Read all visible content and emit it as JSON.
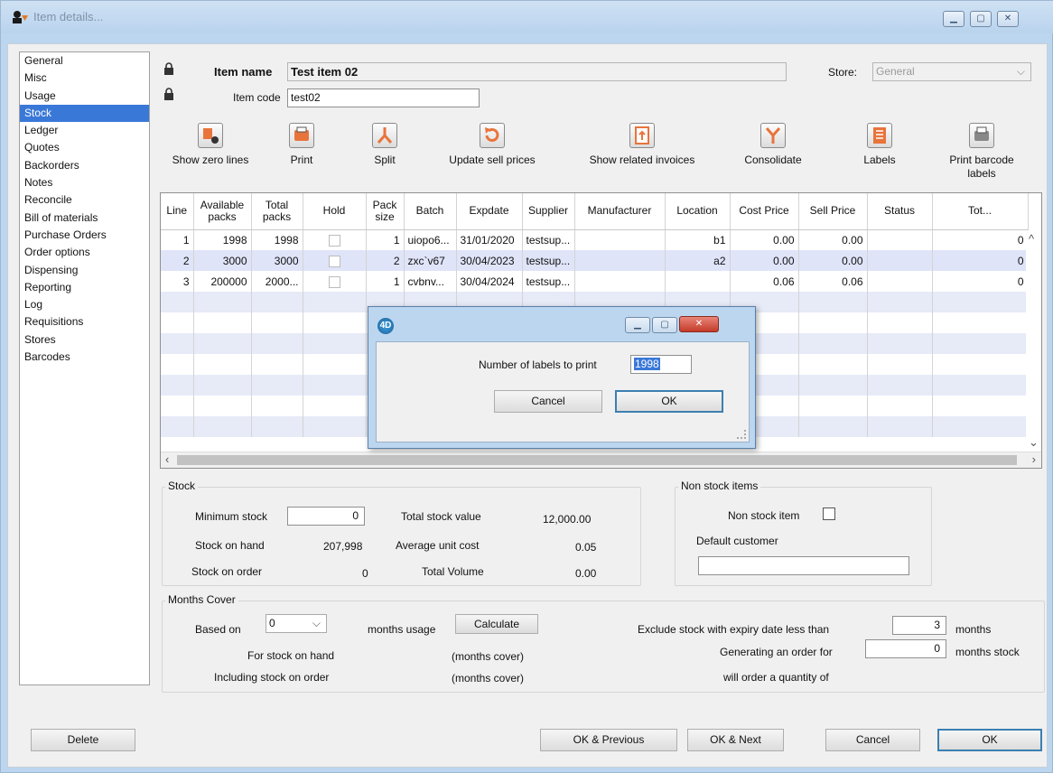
{
  "window": {
    "title": "Item details..."
  },
  "nav": {
    "items": [
      "General",
      "Misc",
      "Usage",
      "Stock",
      "Ledger",
      "Quotes",
      "Backorders",
      "Notes",
      "Reconcile",
      "Bill of materials",
      "Purchase Orders",
      "Order options",
      "Dispensing",
      "Reporting",
      "Log",
      "Requisitions",
      "Stores",
      "Barcodes"
    ],
    "selected": "Stock"
  },
  "header": {
    "item_name_label": "Item name",
    "item_name_value": "Test item 02",
    "item_code_label": "Item code",
    "item_code_value": "test02",
    "store_label": "Store:",
    "store_value": "General"
  },
  "toolbar": {
    "show_zero_lines": "Show zero lines",
    "print": "Print",
    "split": "Split",
    "update_sell_prices": "Update sell prices",
    "show_related_invoices": "Show related invoices",
    "consolidate": "Consolidate",
    "labels": "Labels",
    "print_barcode_labels": "Print barcode labels"
  },
  "table": {
    "columns": [
      "Line",
      "Available packs",
      "Total packs",
      "Hold",
      "Pack size",
      "Batch",
      "Expdate",
      "Supplier",
      "Manufacturer",
      "Location",
      "Cost Price",
      "Sell Price",
      "Status",
      "Tot..."
    ],
    "rows": [
      {
        "line": "1",
        "available": "1998",
        "total": "1998",
        "pack": "1",
        "batch": "uiopo6...",
        "expdate": "31/01/2020",
        "supplier": "testsup...",
        "manufacturer": "",
        "location": "b1",
        "cost": "0.00",
        "sell": "0.00",
        "status": "",
        "tot": "0"
      },
      {
        "line": "2",
        "available": "3000",
        "total": "3000",
        "pack": "2",
        "batch": "zxc`v67",
        "expdate": "30/04/2023",
        "supplier": "testsup...",
        "manufacturer": "",
        "location": "a2",
        "cost": "0.00",
        "sell": "0.00",
        "status": "",
        "tot": "0"
      },
      {
        "line": "3",
        "available": "200000",
        "total": "2000...",
        "pack": "1",
        "batch": "cvbnv...",
        "expdate": "30/04/2024",
        "supplier": "testsup...",
        "manufacturer": "",
        "location": "",
        "cost": "0.06",
        "sell": "0.06",
        "status": "",
        "tot": "0"
      }
    ]
  },
  "stock": {
    "legend": "Stock",
    "minimum_stock_label": "Minimum stock",
    "minimum_stock_value": "0",
    "total_stock_value_label": "Total stock value",
    "total_stock_value": "12,000.00",
    "stock_on_hand_label": "Stock on hand",
    "stock_on_hand": "207,998",
    "average_unit_cost_label": "Average unit cost",
    "average_unit_cost": "0.05",
    "stock_on_order_label": "Stock on order",
    "stock_on_order": "0",
    "total_volume_label": "Total Volume",
    "total_volume": "0.00"
  },
  "non_stock": {
    "legend": "Non stock items",
    "non_stock_item_label": "Non stock item",
    "default_customer_label": "Default customer",
    "default_customer_value": ""
  },
  "months_cover": {
    "legend": "Months Cover",
    "based_on_label": "Based on",
    "based_on_value": "0",
    "months_usage_label": "months usage",
    "calculate_button": "Calculate",
    "for_stock_on_hand_label": "For stock on hand",
    "for_stock_on_hand_value": "(months cover)",
    "including_stock_on_order_label": "Including stock on order",
    "including_stock_on_order_value": "(months cover)",
    "exclude_label": "Exclude stock with expiry date less than",
    "exclude_value": "3",
    "exclude_unit": "months",
    "generating_label": "Generating an order for",
    "generating_value": "0",
    "generating_unit": "months stock",
    "will_order_label": "will order a quantity of"
  },
  "footer": {
    "delete": "Delete",
    "ok_previous": "OK & Previous",
    "ok_next": "OK & Next",
    "cancel": "Cancel",
    "ok": "OK"
  },
  "dialog": {
    "prompt": "Number of labels to print",
    "value": "1998",
    "cancel": "Cancel",
    "ok": "OK"
  }
}
